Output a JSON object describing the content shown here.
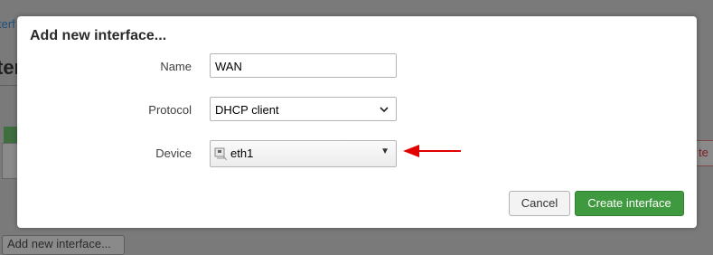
{
  "background": {
    "link_fragment": "terf",
    "heading_fragment": "ter",
    "right_button_fragment": "te",
    "bottom_button_fragment": "Add new interface..."
  },
  "dialog": {
    "title": "Add new interface...",
    "fields": {
      "name": {
        "label": "Name",
        "value": "WAN"
      },
      "protocol": {
        "label": "Protocol",
        "value": "DHCP client"
      },
      "device": {
        "label": "Device",
        "value": "eth1",
        "icon": "ethernet-port-icon"
      }
    },
    "buttons": {
      "cancel": "Cancel",
      "create": "Create interface"
    }
  },
  "annotation": {
    "icon": "red-arrow-left",
    "color": "#e00000"
  },
  "colors": {
    "primary": "#3f9a3f",
    "overlay": "#7a7a7a"
  }
}
